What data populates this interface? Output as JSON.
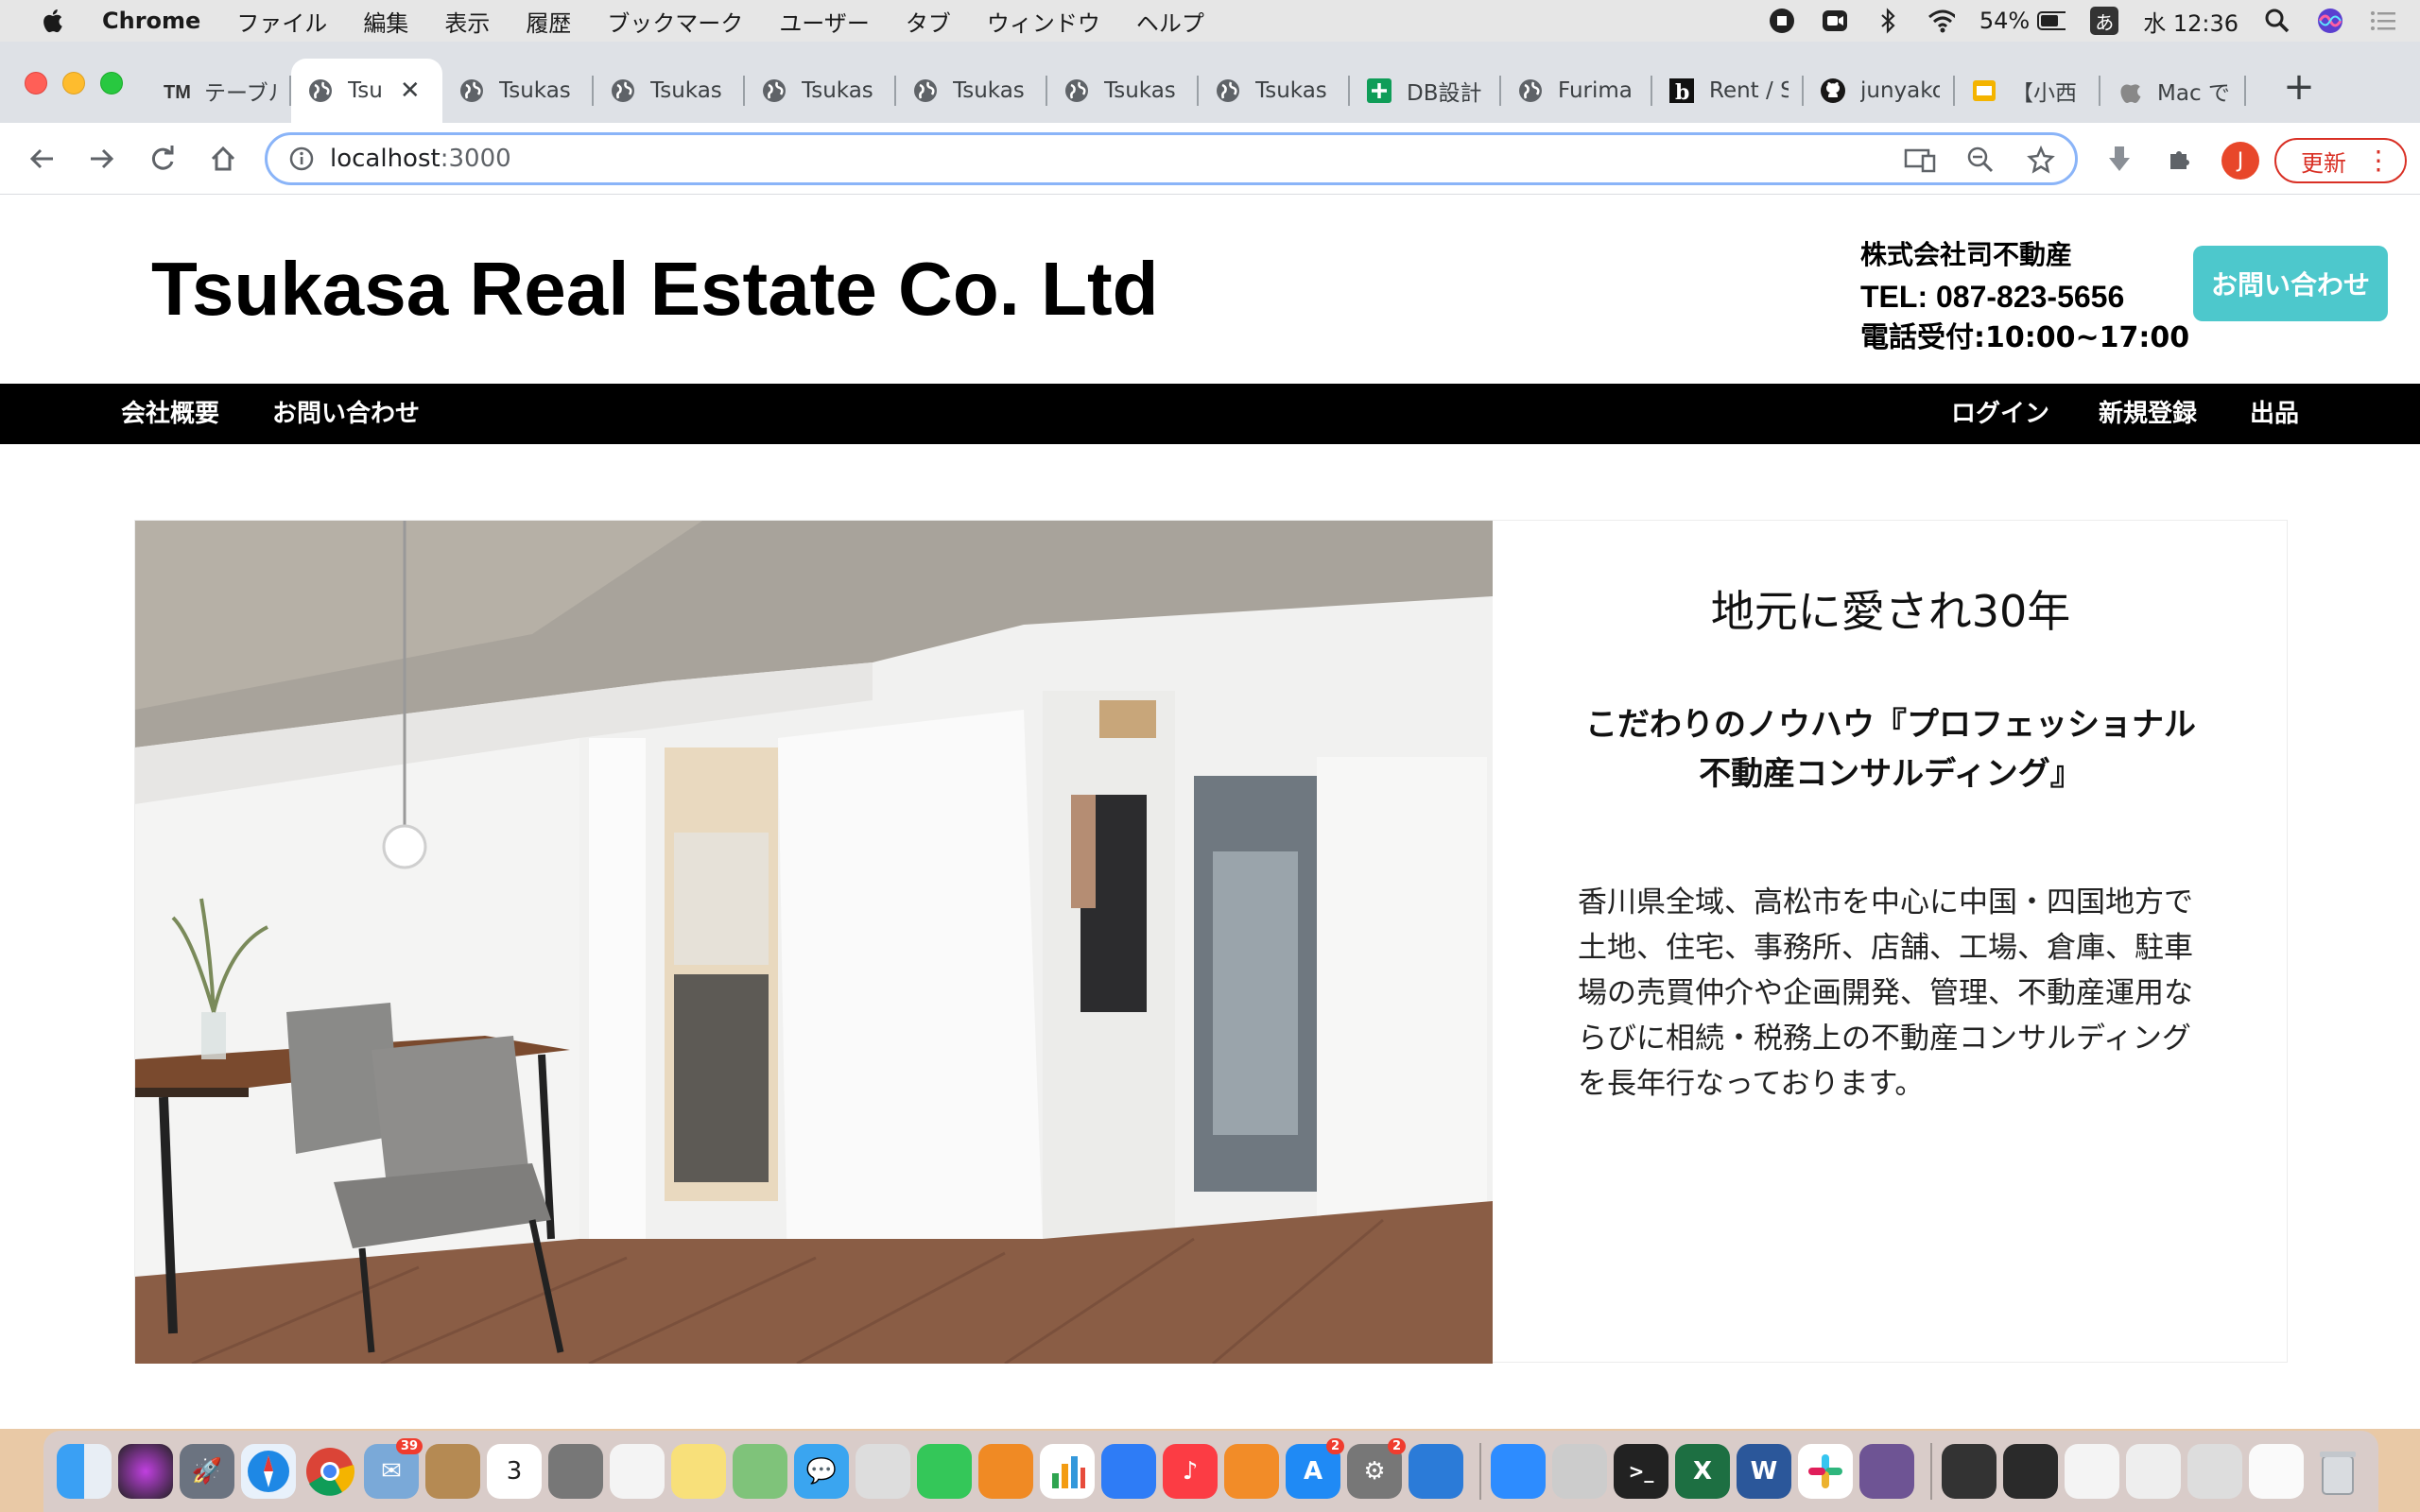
{
  "menubar": {
    "app_name": "Chrome",
    "items": [
      "ファイル",
      "編集",
      "表示",
      "履歴",
      "ブックマーク",
      "ユーザー",
      "タブ",
      "ウィンドウ",
      "ヘルプ"
    ],
    "battery": "54%",
    "input_method": "あ",
    "clock": "水 12:36"
  },
  "tabs": [
    {
      "label": "テーブル",
      "favicon": "tm-icon",
      "active": false
    },
    {
      "label": "Tsu",
      "favicon": "globe-icon",
      "active": true
    },
    {
      "label": "Tsukas",
      "favicon": "globe-icon",
      "active": false
    },
    {
      "label": "Tsukas",
      "favicon": "globe-icon",
      "active": false
    },
    {
      "label": "Tsukas",
      "favicon": "globe-icon",
      "active": false
    },
    {
      "label": "Tsukas",
      "favicon": "globe-icon",
      "active": false
    },
    {
      "label": "Tsukas",
      "favicon": "globe-icon",
      "active": false
    },
    {
      "label": "Tsukas",
      "favicon": "globe-icon",
      "active": false
    },
    {
      "label": "DB設計",
      "favicon": "sheets-icon",
      "active": false
    },
    {
      "label": "Furima",
      "favicon": "globe-icon",
      "active": false
    },
    {
      "label": "Rent / S",
      "favicon": "b-icon",
      "active": false
    },
    {
      "label": "junyako",
      "favicon": "github-icon",
      "active": false
    },
    {
      "label": "【小西",
      "favicon": "slides-icon",
      "active": false
    },
    {
      "label": "Mac で",
      "favicon": "apple-icon",
      "active": false
    }
  ],
  "toolbar": {
    "url_host": "localhost",
    "url_port": ":3000",
    "avatar_letter": "J",
    "update_label": "更新"
  },
  "site": {
    "title": "Tsukasa Real Estate Co. Ltd",
    "company_name": "株式会社司不動産",
    "tel": "TEL: 087-823-5656",
    "hours": "電話受付:10:00~17:00",
    "contact_button": "お問い合わせ",
    "nav_left": [
      "会社概要",
      "お問い合わせ"
    ],
    "nav_right": [
      "ログイン",
      "新規登録",
      "出品"
    ]
  },
  "hero": {
    "title": "地元に愛され30年",
    "subtitle": "こだわりのノウハウ『プロフェッショナル不動産コンサルディング』",
    "body": "香川県全域、高松市を中心に中国・四国地方で土地、住宅、事務所、店舗、工場、倉庫、駐車場の売買仲介や企画開発、管理、不動産運用ならびに相続・税務上の不動産コンサルディングを長年行なっております。"
  },
  "dock": {
    "calendar_day": "3",
    "badges": {
      "mail": "39",
      "appstore": "2",
      "prefs": "2"
    }
  },
  "colors": {
    "accent_teal": "#4dc8cc",
    "nav_black": "#000000",
    "update_red": "#d93025"
  }
}
